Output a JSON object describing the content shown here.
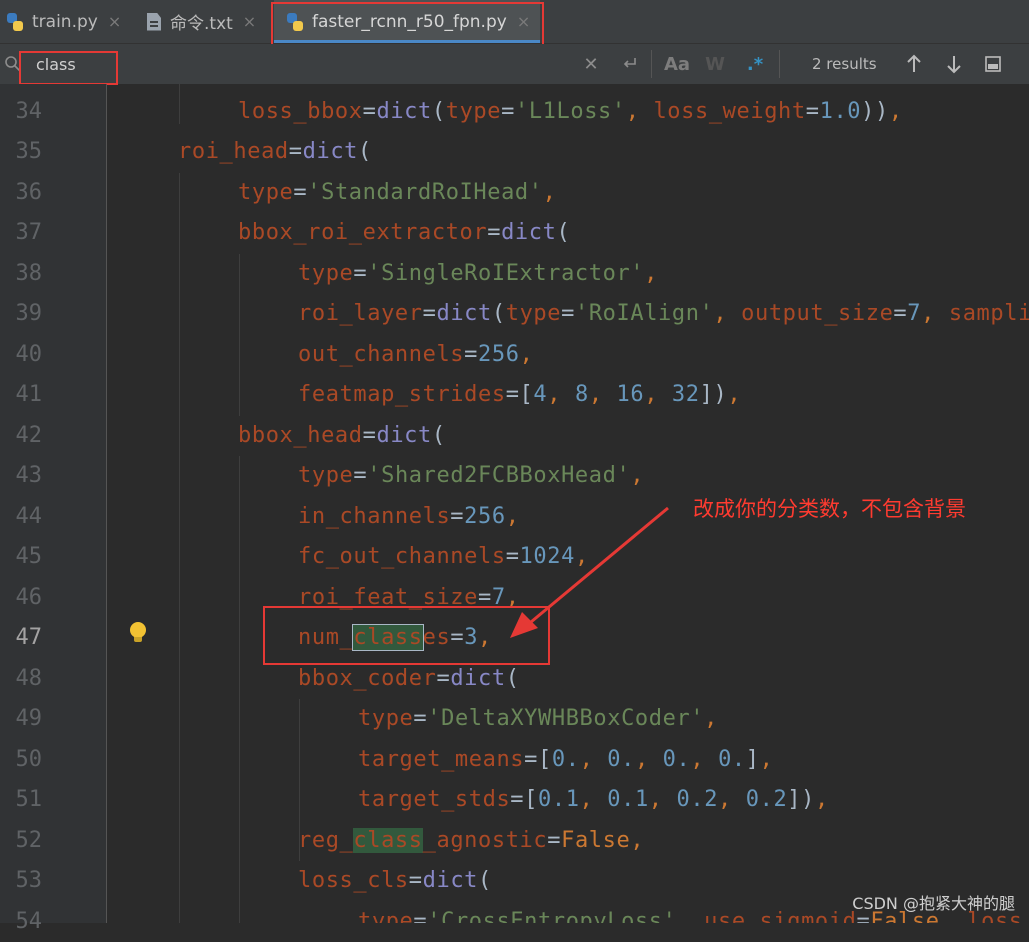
{
  "tabs": [
    {
      "label": "train.py",
      "icon": "python-file-icon",
      "close": "×"
    },
    {
      "label": "命令.txt",
      "icon": "text-file-icon",
      "close": "×"
    },
    {
      "label": "faster_rcnn_r50_fpn.py",
      "icon": "python-file-icon",
      "close": "×",
      "active": true
    }
  ],
  "search": {
    "value": "class",
    "results_label": "2 results",
    "match_case_label": "Aa",
    "words_label": "W",
    "regex_label": ".*"
  },
  "line_numbers": [
    "34",
    "35",
    "36",
    "37",
    "38",
    "39",
    "40",
    "41",
    "42",
    "43",
    "44",
    "45",
    "46",
    "47",
    "48",
    "49",
    "50",
    "51",
    "52",
    "53",
    "54"
  ],
  "current_line": "47",
  "annotation": "改成你的分类数，不包含背景",
  "watermark": "CSDN @抱紧大神的腿",
  "colors": {
    "keyword": "#cc7832",
    "parameter": "#aa4926",
    "builtin": "#8888c6",
    "string": "#6a8759",
    "number": "#6897bb",
    "annotation": "#ff3b30",
    "highlight_box": "#e53935",
    "tab_underline": "#4a88c7"
  }
}
